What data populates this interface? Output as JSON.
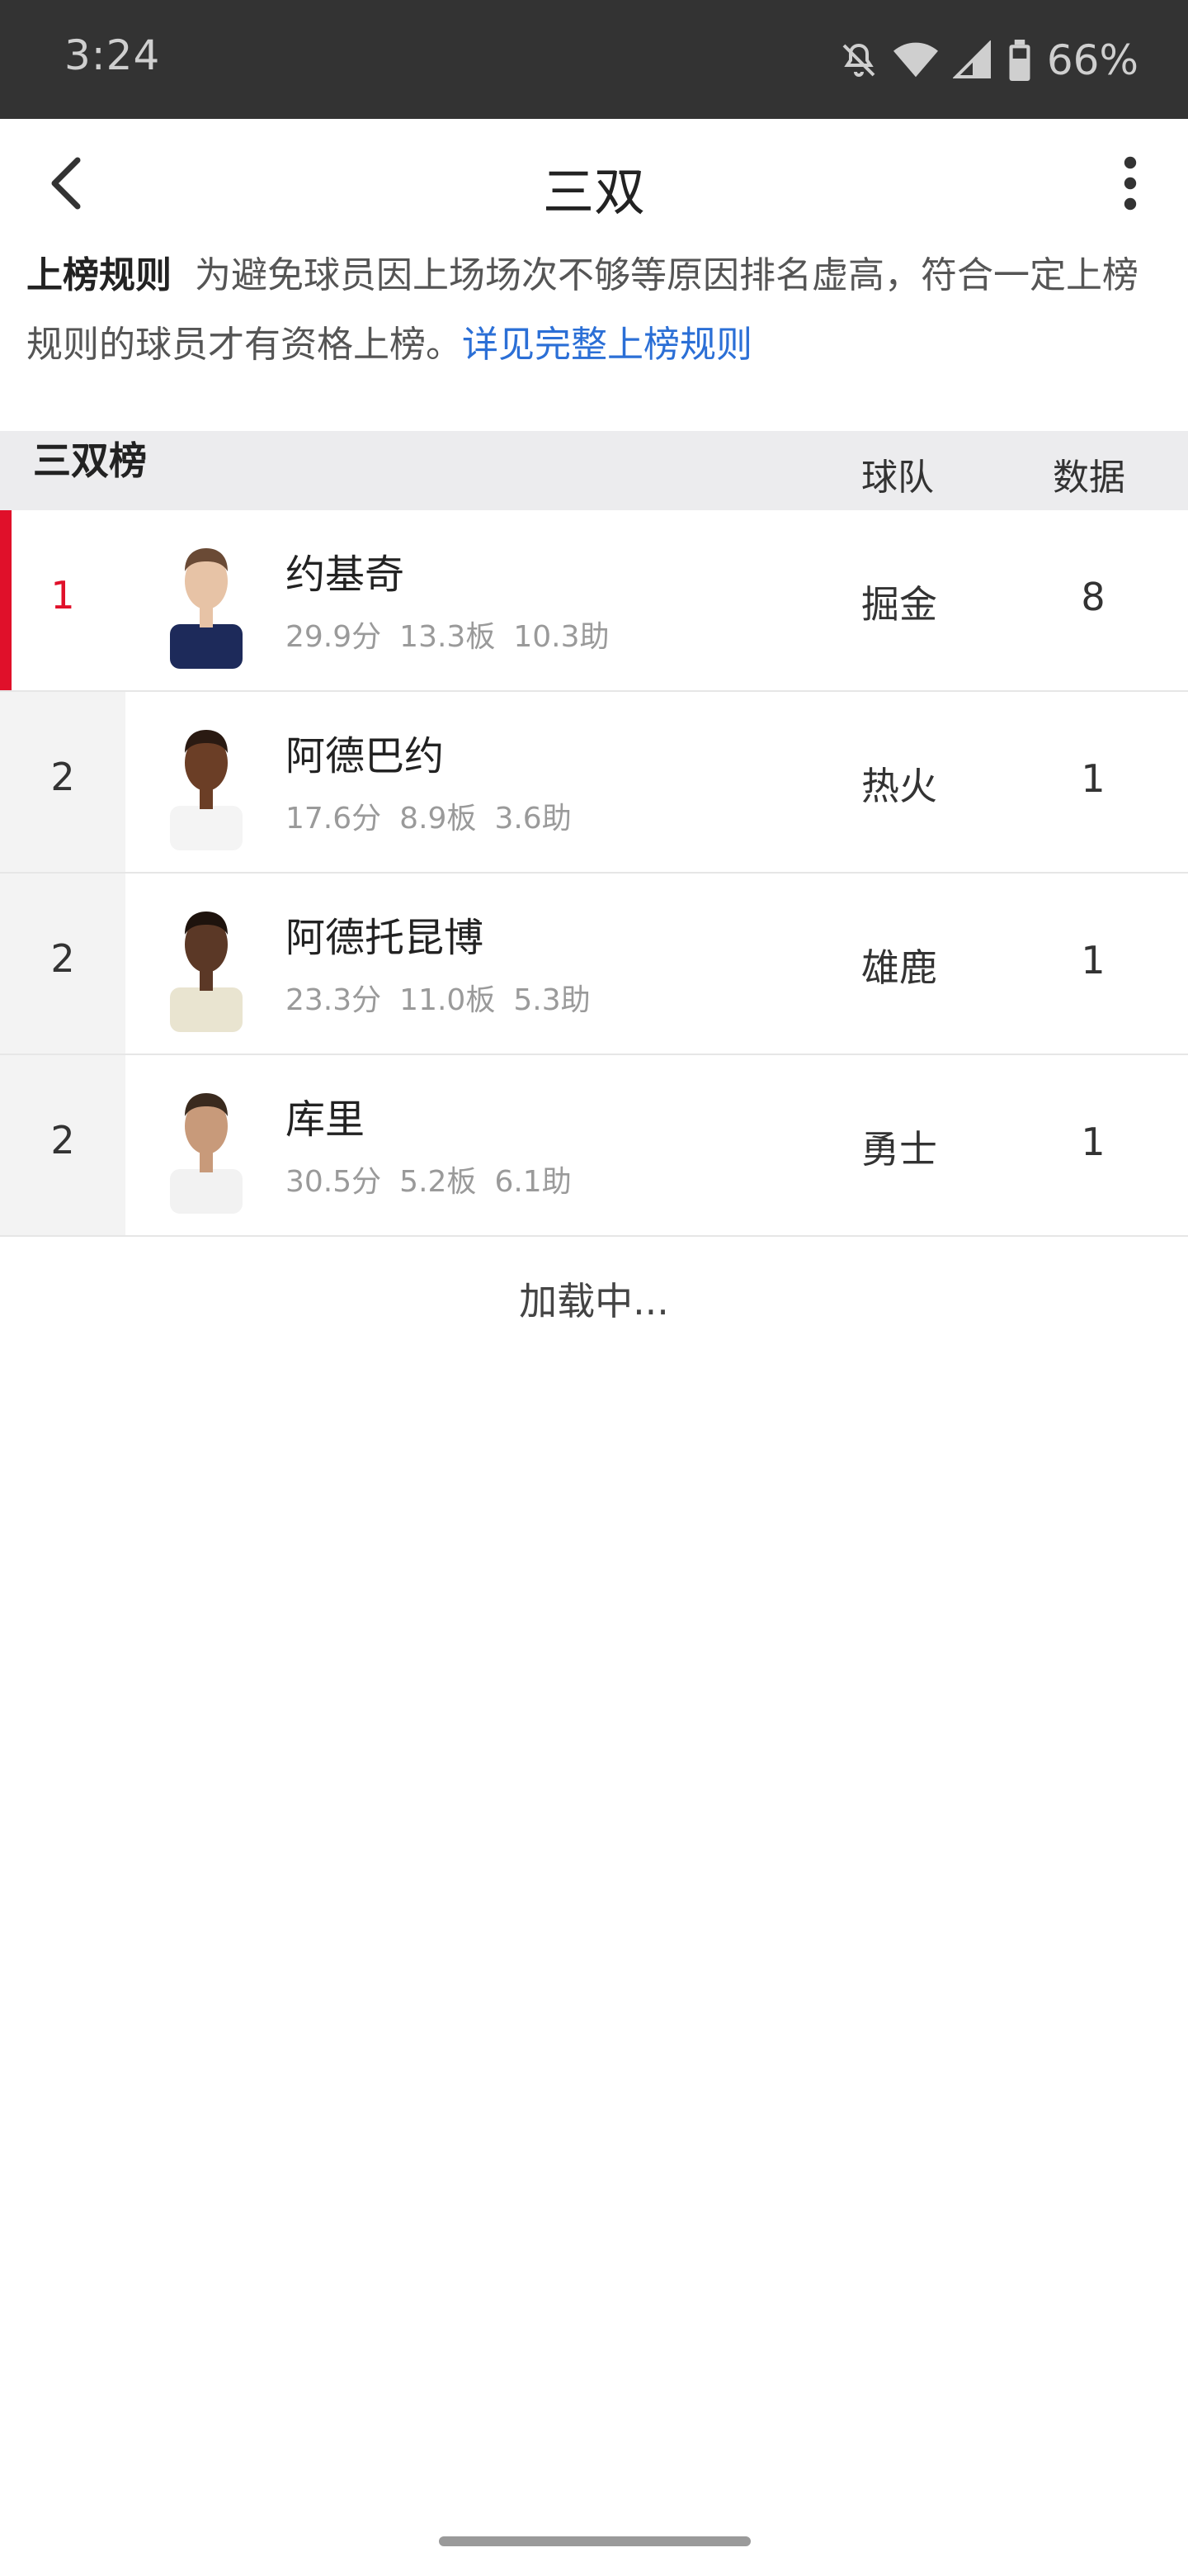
{
  "status_bar": {
    "time": "3:24",
    "battery_text": "66%",
    "icons": [
      "mute-icon",
      "wifi-icon",
      "signal-icon",
      "battery-icon"
    ]
  },
  "app_bar": {
    "title": "三双",
    "back_icon": "chevron-left-icon",
    "more_icon": "more-vertical-icon"
  },
  "rules": {
    "title": "上榜规则",
    "text": "为避免球员因上场场次不够等原因排名虚高，符合一定上榜规则的球员才有资格上榜。",
    "link": "详见完整上榜规则"
  },
  "table": {
    "title": "三双榜",
    "col_team": "球队",
    "col_stat": "数据",
    "rows": [
      {
        "rank": "1",
        "name": "约基奇",
        "pts": "29.9分",
        "reb": "13.3板",
        "ast": "10.3助",
        "team": "掘金",
        "value": "8",
        "jersey_color": "#1d2a5a",
        "skin": "#e7c3a6",
        "hair": "#6a4a35"
      },
      {
        "rank": "2",
        "name": "阿德巴约",
        "pts": "17.6分",
        "reb": "8.9板",
        "ast": "3.6助",
        "team": "热火",
        "value": "1",
        "jersey_color": "#f4f4f4",
        "skin": "#6b3e26",
        "hair": "#2a1a12"
      },
      {
        "rank": "2",
        "name": "阿德托昆博",
        "pts": "23.3分",
        "reb": "11.0板",
        "ast": "5.3助",
        "team": "雄鹿",
        "value": "1",
        "jersey_color": "#e9e4d0",
        "skin": "#5b3826",
        "hair": "#1e130d"
      },
      {
        "rank": "2",
        "name": "库里",
        "pts": "30.5分",
        "reb": "5.2板",
        "ast": "6.1助",
        "team": "勇士",
        "value": "1",
        "jersey_color": "#f2f2f2",
        "skin": "#c89a7a",
        "hair": "#3a2a1e"
      }
    ],
    "loading": "加载中..."
  },
  "colors": {
    "accent_red": "#e0102a",
    "link_blue": "#2b6fd6",
    "status_bar_bg": "#333333"
  }
}
